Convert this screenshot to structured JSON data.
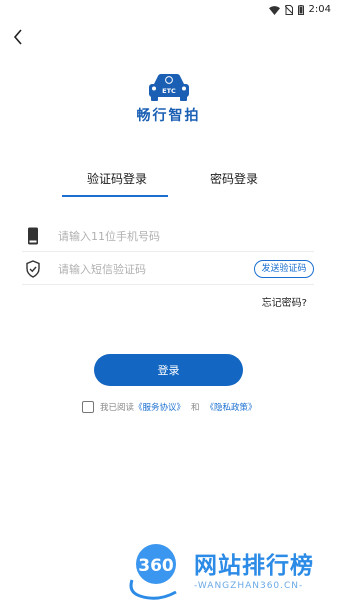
{
  "status_bar": {
    "time": "2:04"
  },
  "logo": {
    "badge_text": "ETC",
    "app_name": "畅行智拍"
  },
  "tabs": [
    {
      "label": "验证码登录",
      "active": true
    },
    {
      "label": "密码登录",
      "active": false
    }
  ],
  "form": {
    "phone": {
      "placeholder": "请输入11位手机号码",
      "value": ""
    },
    "code": {
      "placeholder": "请输入短信验证码",
      "value": ""
    },
    "send_code_label": "发送验证码",
    "forgot_label": "忘记密码?"
  },
  "login": {
    "label": "登录"
  },
  "agreement": {
    "checked": false,
    "prefix": "我已阅读",
    "service_link": "《服务协议》",
    "and": "和",
    "privacy_link": "《隐私政策》"
  },
  "watermark": {
    "logo_text": "360",
    "title": "网站排行榜",
    "subtitle": "-WANGZHAN360.CN-"
  },
  "colors": {
    "primary": "#1366c2",
    "accent": "#1a6fd0",
    "logo": "#1a5fb4"
  }
}
